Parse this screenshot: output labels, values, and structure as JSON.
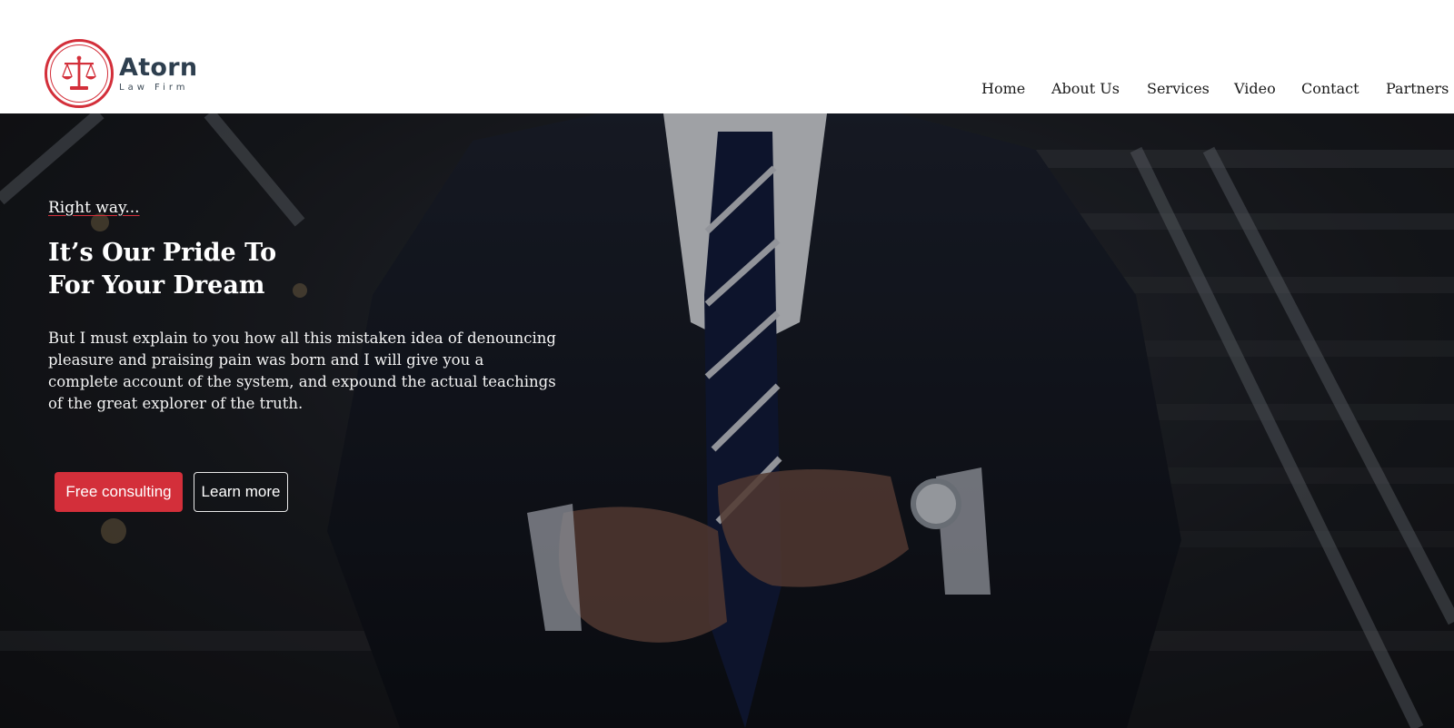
{
  "brand": {
    "name": "Atorn",
    "tagline": "Law Firm",
    "accent_color": "#d32f3a",
    "emblem_icon": "scales-of-justice-icon"
  },
  "nav": {
    "items": [
      {
        "label": "Home"
      },
      {
        "label": "About Us"
      },
      {
        "label": "Services"
      },
      {
        "label": "Video"
      },
      {
        "label": "Contact"
      },
      {
        "label": "Partners"
      }
    ]
  },
  "hero": {
    "kicker": "Right way...",
    "title_line1": "It’s Our Pride To",
    "title_line2": "For Your Dream",
    "body": "But I must explain to you how all this mistaken idea of denouncing pleasure and praising pain was born and I will give you a complete account of the system, and expound the actual teachings of the great explorer of the truth.",
    "primary_button": "Free consulting",
    "secondary_button": "Learn more"
  }
}
